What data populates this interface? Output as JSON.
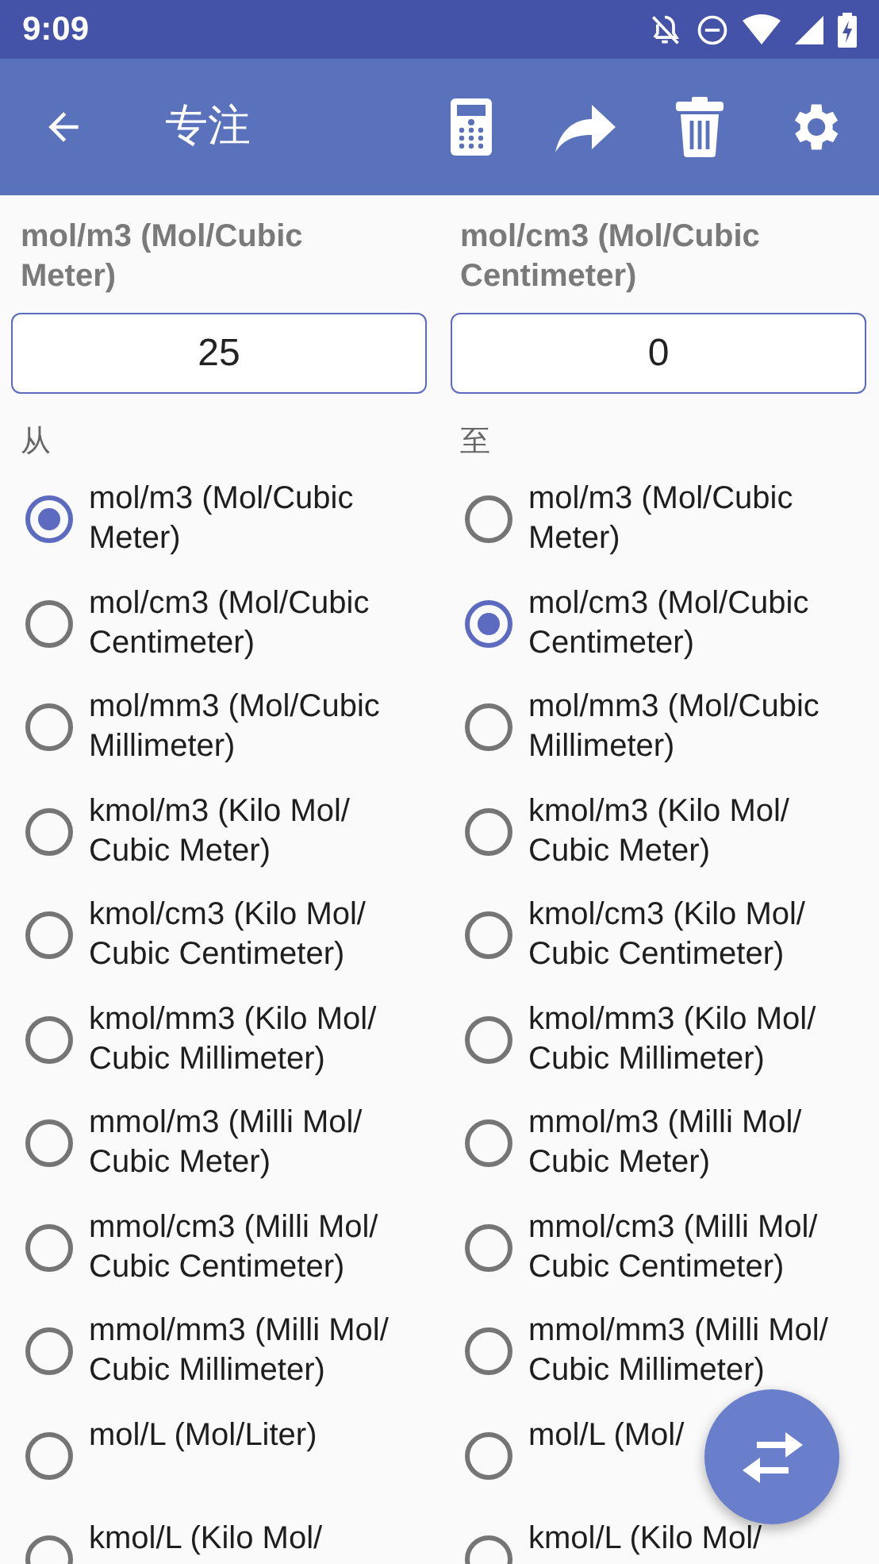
{
  "status_bar": {
    "time": "9:09"
  },
  "toolbar": {
    "title": "专注"
  },
  "from": {
    "unit": "mol/m3 (Mol/Cubic Meter)",
    "value": "25",
    "caption": "从",
    "options": [
      {
        "label": "mol/m3 (Mol/Cubic Meter)",
        "selected": true
      },
      {
        "label": "mol/cm3 (Mol/Cubic Centimeter)",
        "selected": false
      },
      {
        "label": "mol/mm3 (Mol/Cubic Millimeter)",
        "selected": false
      },
      {
        "label": "kmol/m3 (Kilo Mol/Cubic Meter)",
        "selected": false
      },
      {
        "label": "kmol/cm3 (Kilo Mol/Cubic Centimeter)",
        "selected": false
      },
      {
        "label": "kmol/mm3 (Kilo Mol/Cubic Millimeter)",
        "selected": false
      },
      {
        "label": "mmol/m3 (Milli Mol/Cubic Meter)",
        "selected": false
      },
      {
        "label": "mmol/cm3 (Milli Mol/Cubic Centimeter)",
        "selected": false
      },
      {
        "label": "mmol/mm3 (Milli Mol/Cubic Millimeter)",
        "selected": false
      },
      {
        "label": "mol/L (Mol/Liter)",
        "selected": false
      },
      {
        "label": "kmol/L (Kilo Mol/",
        "selected": false
      }
    ]
  },
  "to": {
    "unit": "mol/cm3 (Mol/Cubic Centimeter)",
    "value": "0",
    "caption": "至",
    "options": [
      {
        "label": "mol/m3 (Mol/Cubic Meter)",
        "selected": false
      },
      {
        "label": "mol/cm3 (Mol/Cubic Centimeter)",
        "selected": true
      },
      {
        "label": "mol/mm3 (Mol/Cubic Millimeter)",
        "selected": false
      },
      {
        "label": "kmol/m3 (Kilo Mol/Cubic Meter)",
        "selected": false
      },
      {
        "label": "kmol/cm3 (Kilo Mol/Cubic Centimeter)",
        "selected": false
      },
      {
        "label": "kmol/mm3 (Kilo Mol/Cubic Millimeter)",
        "selected": false
      },
      {
        "label": "mmol/m3 (Milli Mol/Cubic Meter)",
        "selected": false
      },
      {
        "label": "mmol/cm3 (Milli Mol/Cubic Centimeter)",
        "selected": false
      },
      {
        "label": "mmol/mm3 (Milli Mol/Cubic Millimeter)",
        "selected": false
      },
      {
        "label": "mol/L (Mol/",
        "selected": false
      },
      {
        "label": "kmol/L (Kilo Mol/",
        "selected": false
      }
    ]
  }
}
